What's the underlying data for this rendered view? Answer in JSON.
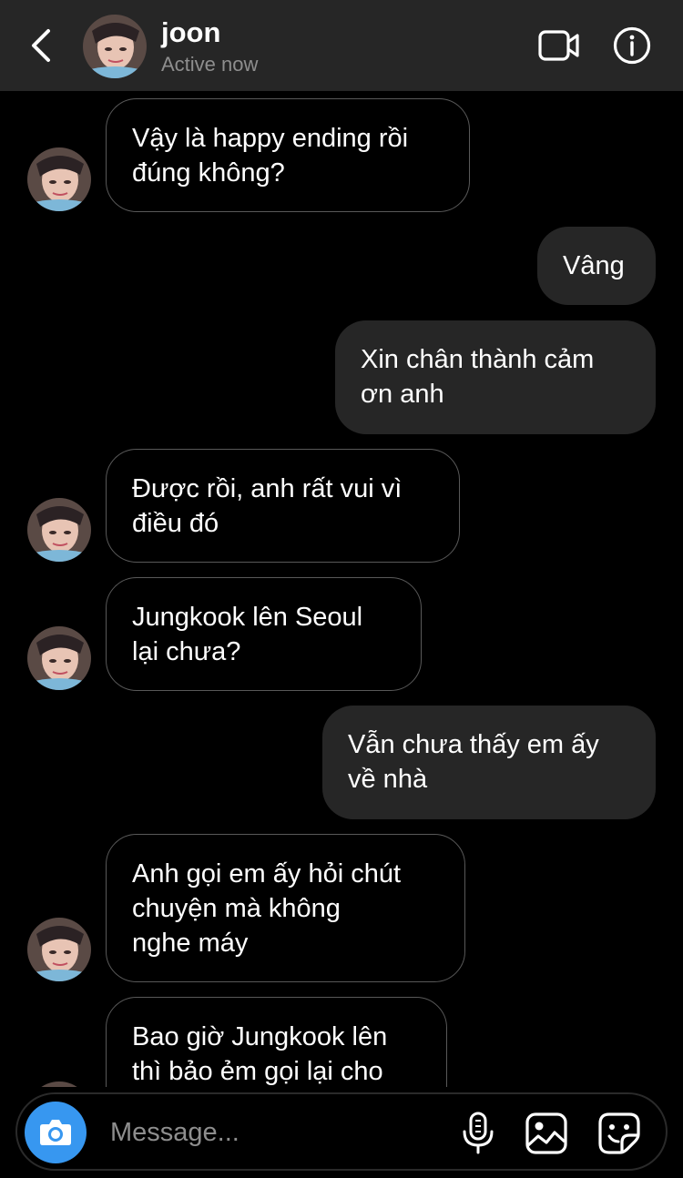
{
  "header": {
    "name": "joon",
    "status": "Active now"
  },
  "messages": [
    {
      "direction": "in",
      "text": "Vậy là happy ending rồi\nđúng không?"
    },
    {
      "direction": "out",
      "text": "Vâng"
    },
    {
      "direction": "out",
      "text": "Xin chân thành cảm\nơn anh"
    },
    {
      "direction": "in",
      "text": "Được rồi, anh rất vui vì\nđiều đó"
    },
    {
      "direction": "in",
      "text": "Jungkook lên Seoul\nlại chưa?"
    },
    {
      "direction": "out",
      "text": "Vẫn chưa thấy em ấy\nvề nhà"
    },
    {
      "direction": "in",
      "text": "Anh gọi em ấy hỏi chút\nchuyện mà  không\nnghe máy"
    },
    {
      "direction": "in",
      "text": "Bao giờ Jungkook lên\nthì bảo ẻm gọi lại cho"
    }
  ],
  "composer": {
    "placeholder": "Message..."
  },
  "icons": {
    "back": "chevron-left-icon",
    "video": "video-camera-icon",
    "info": "info-icon",
    "camera": "camera-icon",
    "mic": "microphone-icon",
    "gallery": "image-gallery-icon",
    "sticker": "sticker-icon"
  },
  "colors": {
    "background": "#000000",
    "header": "#262626",
    "outgoing_bubble": "#262626",
    "incoming_border": "#595959",
    "camera_button": "#3797f0",
    "muted_text": "#8e8e8e"
  }
}
